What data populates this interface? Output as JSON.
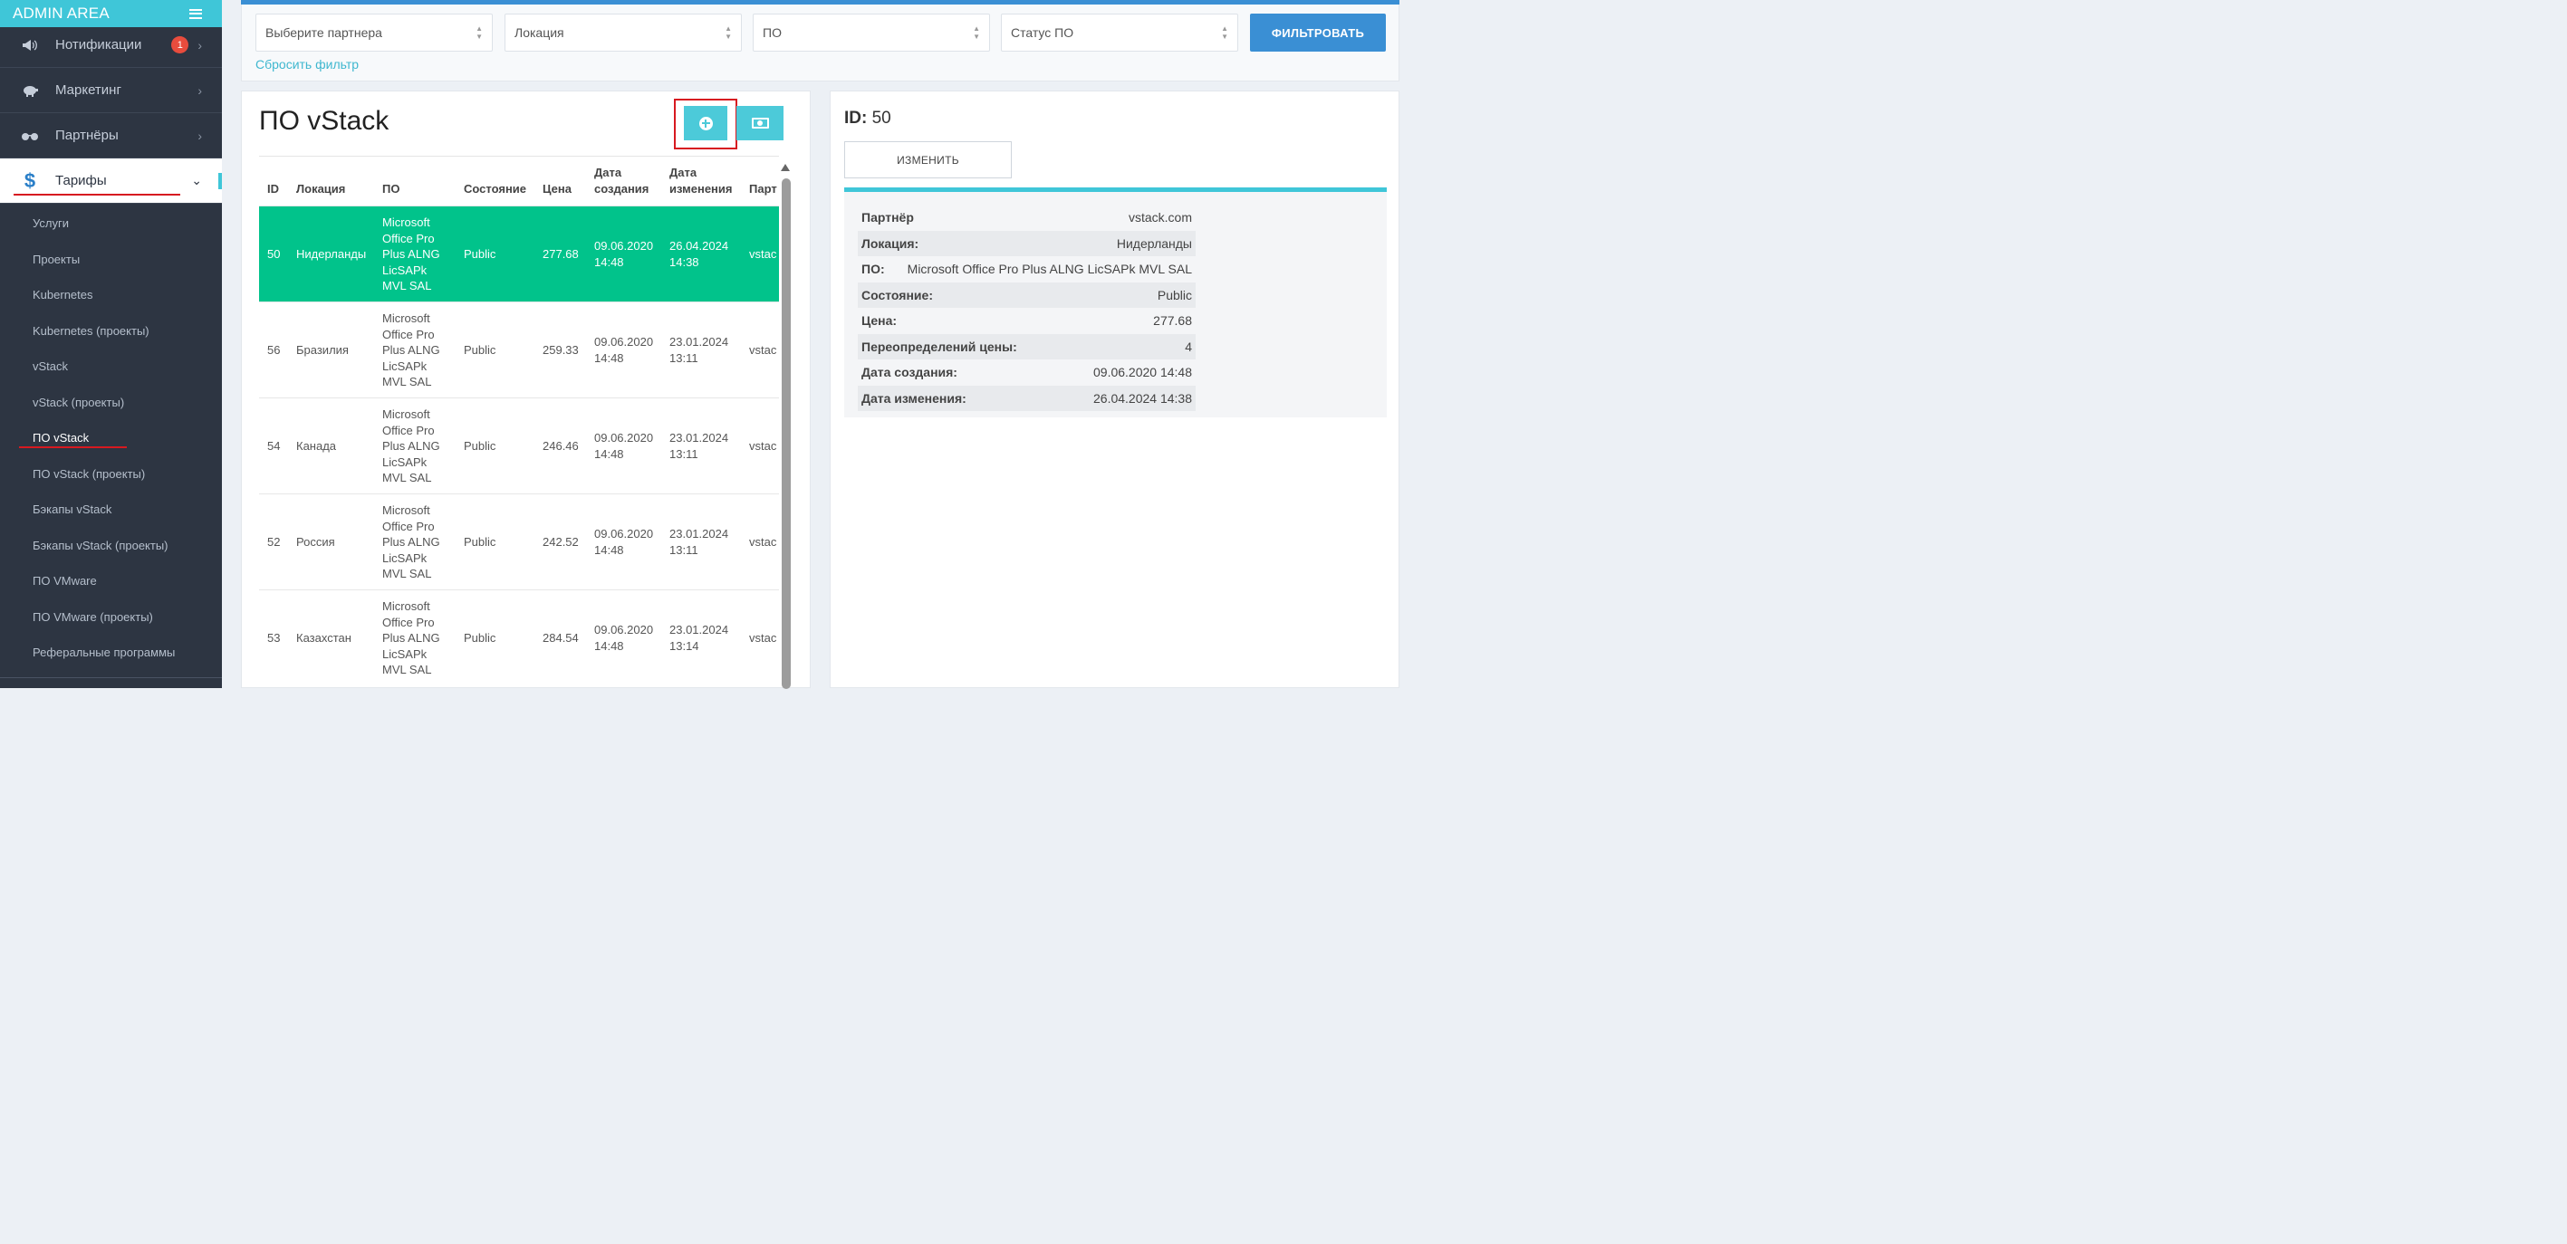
{
  "sidebar": {
    "brand": "ADMIN AREA",
    "menu": [
      {
        "label": "Нотификации",
        "badge": "1"
      },
      {
        "label": "Маркетинг"
      },
      {
        "label": "Партнёры"
      },
      {
        "label": "Тарифы"
      }
    ],
    "active_icon": "$",
    "submenu": [
      "Услуги",
      "Проекты",
      "Kubernetes",
      "Kubernetes (проекты)",
      "vStack",
      "vStack (проекты)",
      "ПО vStack",
      "ПО vStack (проекты)",
      "Бэкапы vStack",
      "Бэкапы vStack (проекты)",
      "ПО VMware",
      "ПО VMware (проекты)",
      "Реферальные программы"
    ]
  },
  "filters": {
    "partner": "Выберите партнера",
    "location": "Локация",
    "software": "ПО",
    "status": "Статус ПО",
    "filter_button": "ФИЛЬТРОВАТЬ",
    "reset_link": "Сбросить фильтр"
  },
  "list": {
    "title": "ПО vStack",
    "columns": [
      "ID",
      "Локация",
      "ПО",
      "Состояние",
      "Цена",
      "Дата\nсоздания",
      "Дата\nизменения",
      "Парт"
    ],
    "rows": [
      {
        "id": "50",
        "location": "Нидерланды",
        "software": "Microsoft\nOffice Pro\nPlus ALNG\nLicSAPk\nMVL SAL",
        "state": "Public",
        "price": "277.68",
        "created": "09.06.2020\n14:48",
        "changed": "26.04.2024\n14:38",
        "partner": "vstac"
      },
      {
        "id": "56",
        "location": "Бразилия",
        "software": "Microsoft\nOffice Pro\nPlus ALNG\nLicSAPk\nMVL SAL",
        "state": "Public",
        "price": "259.33",
        "created": "09.06.2020\n14:48",
        "changed": "23.01.2024\n13:11",
        "partner": "vstac"
      },
      {
        "id": "54",
        "location": "Канада",
        "software": "Microsoft\nOffice Pro\nPlus ALNG\nLicSAPk\nMVL SAL",
        "state": "Public",
        "price": "246.46",
        "created": "09.06.2020\n14:48",
        "changed": "23.01.2024\n13:11",
        "partner": "vstac"
      },
      {
        "id": "52",
        "location": "Россия",
        "software": "Microsoft\nOffice Pro\nPlus ALNG\nLicSAPk\nMVL SAL",
        "state": "Public",
        "price": "242.52",
        "created": "09.06.2020\n14:48",
        "changed": "23.01.2024\n13:11",
        "partner": "vstac"
      },
      {
        "id": "53",
        "location": "Казахстан",
        "software": "Microsoft\nOffice Pro\nPlus ALNG\nLicSAPk\nMVL SAL",
        "state": "Public",
        "price": "284.54",
        "created": "09.06.2020\n14:48",
        "changed": "23.01.2024\n13:14",
        "partner": "vstac"
      }
    ]
  },
  "detail": {
    "id_label": "ID:",
    "id_value": "50",
    "edit_button": "ИЗМЕНИТЬ",
    "fields": [
      {
        "k": "Партнёр",
        "v": "vstack.com"
      },
      {
        "k": "Локация:",
        "v": "Нидерланды"
      },
      {
        "k": "ПО:",
        "v": "Microsoft Office Pro Plus ALNG LicSAPk MVL SAL"
      },
      {
        "k": "Состояние:",
        "v": "Public"
      },
      {
        "k": "Цена:",
        "v": "277.68"
      },
      {
        "k": "Переопределений цены:",
        "v": "4"
      },
      {
        "k": "Дата создания:",
        "v": "09.06.2020 14:48"
      },
      {
        "k": "Дата изменения:",
        "v": "26.04.2024 14:38"
      }
    ]
  },
  "colors": {
    "accent": "#3fc6d8",
    "primary": "#3a8fd4",
    "selected_row": "#01c38b",
    "sidebar_bg": "#2d3542",
    "highlight": "#d71920"
  }
}
